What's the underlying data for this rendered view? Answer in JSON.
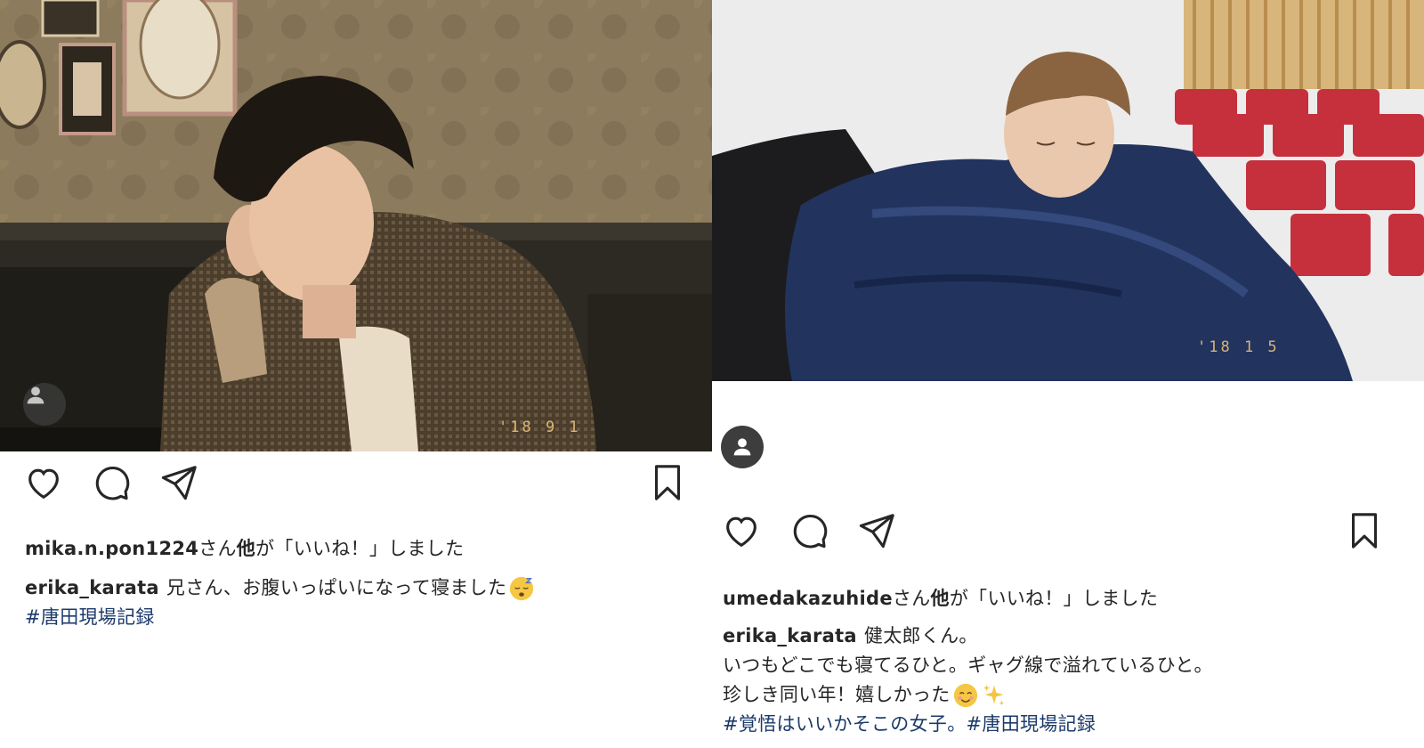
{
  "left_post": {
    "photo_alt": "man resting head on hand in a cafe booth",
    "date_stamp": "'18 9 1",
    "liked_by_user": "mika.n.pon1224",
    "liked_by_suffix_plain": "さん",
    "liked_by_bold": "他",
    "liked_by_rest": "が「いいね！」しました",
    "caption_user": "erika_karata",
    "caption_text": "兄さん、お腹いっぱいになって寝ました",
    "caption_emoji": "sleeping-face-emoji",
    "hashtags": "#唐田現場記録"
  },
  "right_post": {
    "photo_alt": "man sleeping on a navy jacket in a theater with red seats",
    "date_stamp": "'18 1 5",
    "liked_by_user": "umedakazuhide",
    "liked_by_suffix_plain": "さん",
    "liked_by_bold": "他",
    "liked_by_rest": "が「いいね！」しました",
    "caption_user": "erika_karata",
    "caption_line1": "健太郎くん。",
    "caption_line2": "いつもどこでも寝てるひと。ギャグ線で溢れているひと。",
    "caption_line3": "珍しき同い年！嬉しかった",
    "caption_line3_emoji1": "smiling-face-emoji",
    "caption_line3_emoji2": "sparkles-emoji",
    "hashtag_line": "#覚悟はいいかそこの女子。#唐田現場記録"
  },
  "icons": {
    "like": "heart-icon",
    "comment": "comment-icon",
    "share": "paper-plane-icon",
    "save": "bookmark-icon",
    "avatar": "user-avatar-icon"
  },
  "colors": {
    "text": "#262626",
    "hashtag": "#1b3a6b",
    "avatar_bg": "#3d3d3d",
    "seat_red": "#c6303d",
    "jacket_navy": "#22335e"
  }
}
